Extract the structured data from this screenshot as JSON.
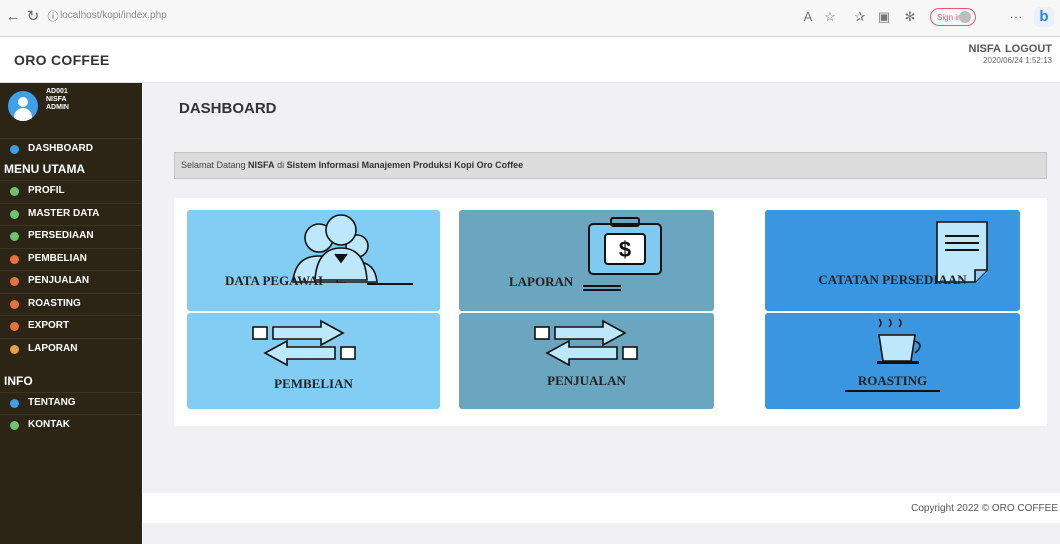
{
  "browser": {
    "url": "localhost/kopi/index.php",
    "signin_label": "Sign in"
  },
  "header": {
    "brand": "ORO COFFEE",
    "user": "NISFA",
    "logout": "LOGOUT",
    "timestamp": "2020/06/24 1:52:13"
  },
  "sidebar": {
    "user_lines": [
      "AD001",
      "NISFA",
      "ADMIN"
    ],
    "dashboard": "DASHBOARD",
    "section_main": "MENU UTAMA",
    "items": [
      {
        "label": "PROFIL",
        "color": "#6ec46e"
      },
      {
        "label": "MASTER DATA",
        "color": "#6ec46e"
      },
      {
        "label": "PERSEDIAAN",
        "color": "#6ec46e"
      },
      {
        "label": "PEMBELIAN",
        "color": "#e8733a"
      },
      {
        "label": "PENJUALAN",
        "color": "#e8733a"
      },
      {
        "label": "ROASTING",
        "color": "#e8733a"
      },
      {
        "label": "EXPORT",
        "color": "#e8733a"
      },
      {
        "label": "LAPORAN",
        "color": "#e8a23a"
      }
    ],
    "section_info": "INFO",
    "info_items": [
      {
        "label": "TENTANG",
        "color": "#3aa0e8"
      },
      {
        "label": "KONTAK",
        "color": "#6ec46e"
      }
    ]
  },
  "main": {
    "title": "DASHBOARD",
    "welcome": {
      "prefix": "Selamat Datang ",
      "name": "NISFA",
      "middle": " di ",
      "system": "Sistem Informasi Manajemen Produksi Kopi Oro Coffee"
    },
    "tiles": [
      {
        "label": "DATA PEGAWAI",
        "color": "#82cdf4",
        "icon": "people-icon"
      },
      {
        "label": "LAPORAN",
        "color": "#6aa6c0",
        "icon": "money-briefcase-icon"
      },
      {
        "label": "CATATAN PERSEDIAAN",
        "color": "#3a96e0",
        "icon": "notepad-icon"
      },
      {
        "label": "PEMBELIAN",
        "color": "#82cdf4",
        "icon": "transfer-arrows-icon"
      },
      {
        "label": "PENJUALAN",
        "color": "#6aa6c0",
        "icon": "transfer-arrows-icon"
      },
      {
        "label": "ROASTING",
        "color": "#3a96e0",
        "icon": "coffee-cup-icon"
      }
    ],
    "footer": "Copyright 2022 © ORO COFFEE"
  }
}
